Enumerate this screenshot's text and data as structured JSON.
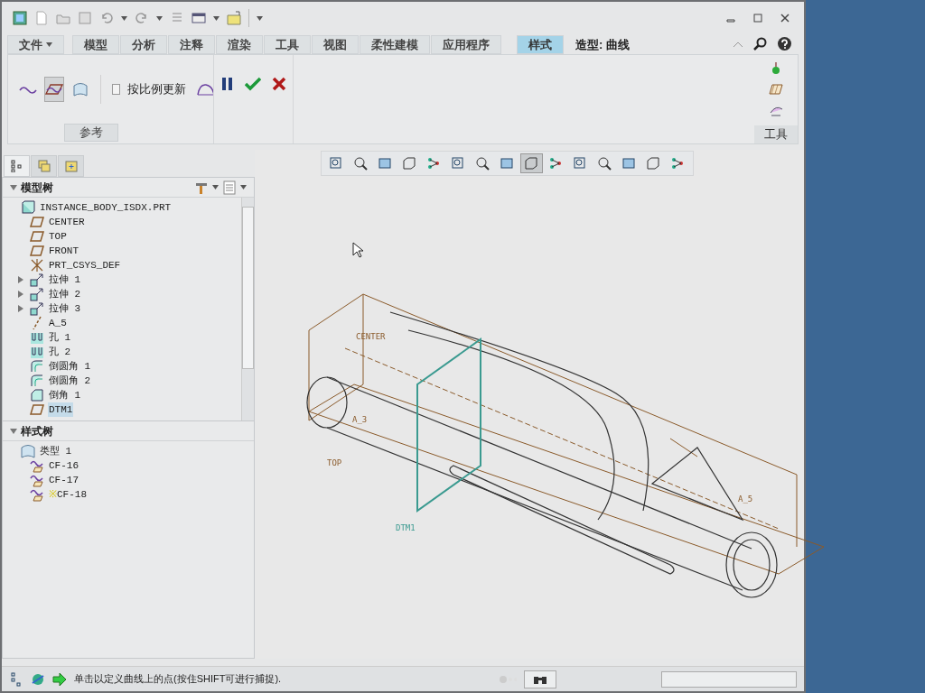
{
  "menu_tabs": [
    {
      "label": "文件",
      "kind": "menu",
      "selected": false
    },
    {
      "label": "模型",
      "kind": "tab",
      "selected": false
    },
    {
      "label": "分析",
      "kind": "tab",
      "selected": false
    },
    {
      "label": "注释",
      "kind": "tab",
      "selected": false
    },
    {
      "label": "渲染",
      "kind": "tab",
      "selected": false
    },
    {
      "label": "工具",
      "kind": "tab",
      "selected": false
    },
    {
      "label": "视图",
      "kind": "tab",
      "selected": false
    },
    {
      "label": "柔性建模",
      "kind": "tab",
      "selected": false
    },
    {
      "label": "应用程序",
      "kind": "tab",
      "selected": false
    },
    {
      "label": "样式",
      "kind": "tab",
      "selected": true
    }
  ],
  "mode_label": "造型: 曲线",
  "ribbon": {
    "curve_types": [
      {
        "selected": false
      },
      {
        "selected": true
      },
      {
        "selected": false
      }
    ],
    "checkbox": {
      "label": "按比例更新",
      "checked": false
    },
    "group_label": "参考",
    "side_group_label": "工具"
  },
  "navigator_tabs": [
    {
      "selected": true
    },
    {
      "selected": false
    },
    {
      "selected": false
    }
  ],
  "model_tree": {
    "title": "模型树",
    "items": [
      {
        "label": "INSTANCE_BODY_ISDX.PRT",
        "kind": "part",
        "selected": false,
        "children": [
          {
            "label": "CENTER",
            "kind": "plane",
            "selected": false
          },
          {
            "label": "TOP",
            "kind": "plane",
            "selected": false
          },
          {
            "label": "FRONT",
            "kind": "plane",
            "selected": false
          },
          {
            "label": "PRT_CSYS_DEF",
            "kind": "csys",
            "selected": false
          },
          {
            "label": "拉伸 1",
            "kind": "extrude",
            "selected": false,
            "expanded": false
          },
          {
            "label": "拉伸 2",
            "kind": "extrude",
            "selected": false,
            "expanded": false
          },
          {
            "label": "拉伸 3",
            "kind": "extrude",
            "selected": false,
            "expanded": false
          },
          {
            "label": "A_5",
            "kind": "axis",
            "selected": false
          },
          {
            "label": "孔 1",
            "kind": "hole",
            "selected": false
          },
          {
            "label": "孔 2",
            "kind": "hole",
            "selected": false
          },
          {
            "label": "倒圆角 1",
            "kind": "round",
            "selected": false
          },
          {
            "label": "倒圆角 2",
            "kind": "round",
            "selected": false
          },
          {
            "label": "倒角 1",
            "kind": "chamfer",
            "selected": false
          },
          {
            "label": "DTM1",
            "kind": "plane",
            "selected": true
          }
        ]
      }
    ]
  },
  "style_tree": {
    "title": "样式树",
    "items": [
      {
        "label": "类型 1",
        "kind": "style",
        "children": [
          {
            "label": "CF-16",
            "kind": "curve"
          },
          {
            "label": "CF-17",
            "kind": "curve"
          },
          {
            "label": "CF-18",
            "kind": "curve",
            "marker": "※"
          }
        ]
      }
    ]
  },
  "view_toolbar": [
    {
      "selected": false
    },
    {
      "selected": false
    },
    {
      "selected": false
    },
    {
      "selected": false
    },
    {
      "selected": false
    },
    {
      "selected": false
    },
    {
      "selected": false
    },
    {
      "selected": false
    },
    {
      "selected": true
    },
    {
      "selected": false
    },
    {
      "selected": false
    },
    {
      "selected": false
    },
    {
      "selected": false
    },
    {
      "selected": false
    },
    {
      "selected": false
    }
  ],
  "viewport": {
    "labels": [
      "CENTER",
      "TOP",
      "DTM1",
      "A_3",
      "A_5"
    ]
  },
  "status_bar": {
    "message": "单击以定义曲线上的点(按住SHIFT可进行捕捉)."
  }
}
